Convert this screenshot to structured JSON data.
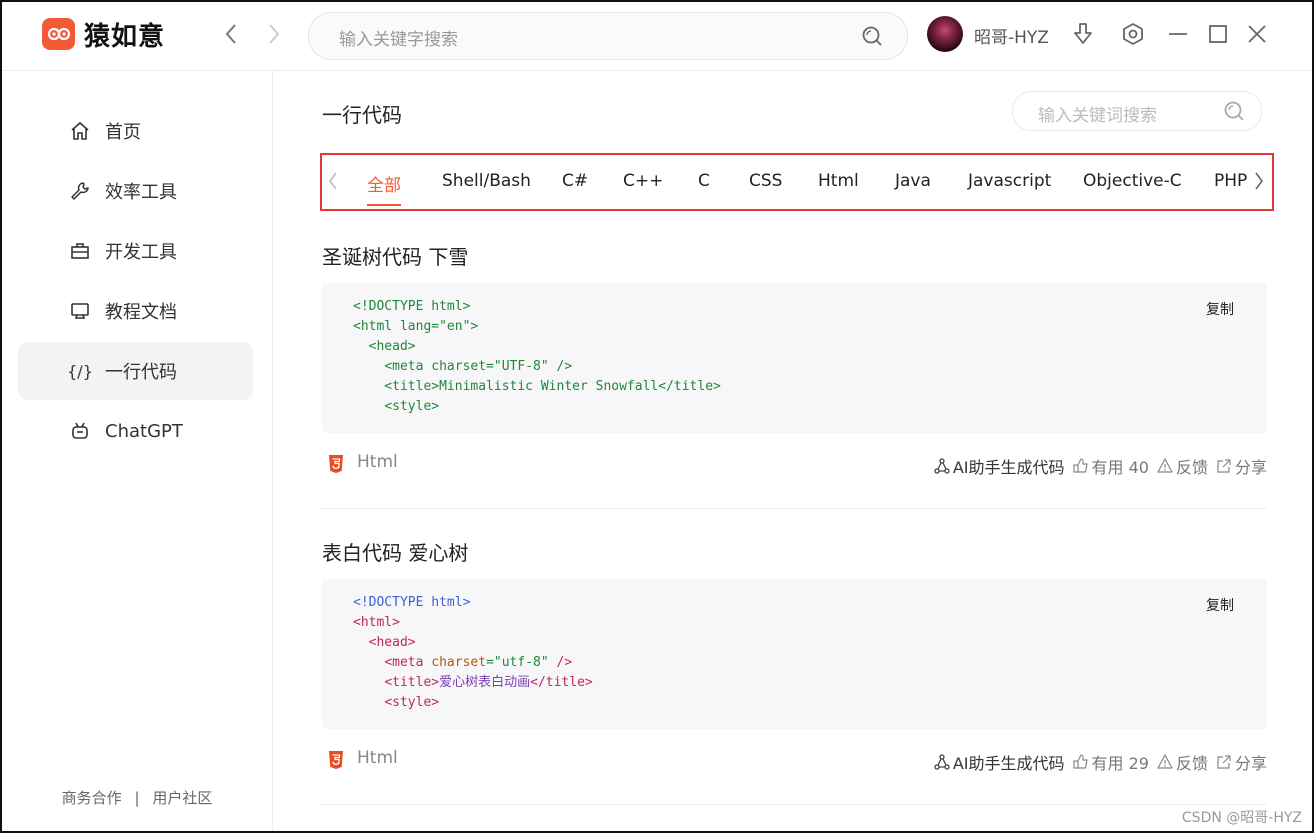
{
  "app": {
    "name": "猿如意"
  },
  "titlebar": {
    "search_placeholder": "输入关键字搜索",
    "username": "昭哥-HYZ"
  },
  "sidebar": {
    "items": [
      {
        "label": "首页",
        "icon": "home-icon"
      },
      {
        "label": "效率工具",
        "icon": "wrench-icon"
      },
      {
        "label": "开发工具",
        "icon": "briefcase-icon"
      },
      {
        "label": "教程文档",
        "icon": "monitor-icon"
      },
      {
        "label": "一行代码",
        "icon": "code-braces-icon",
        "glyph": "{/}",
        "active": true
      },
      {
        "label": "ChatGPT",
        "icon": "robot-icon"
      }
    ],
    "footer": {
      "business": "商务合作",
      "divider": "|",
      "community": "用户社区"
    }
  },
  "main": {
    "title": "一行代码",
    "search_placeholder": "输入关键词搜索",
    "tabs": [
      "全部",
      "Shell/Bash",
      "C#",
      "C++",
      "C",
      "CSS",
      "Html",
      "Java",
      "Javascript",
      "Objective-C",
      "PHP"
    ],
    "active_tab": "全部",
    "snippets": [
      {
        "title": "圣诞树代码 下雪",
        "copy_label": "复制",
        "code": [
          "<!DOCTYPE html>",
          "<html lang=\"en\">",
          "  <head>",
          "    <meta charset=\"UTF-8\" />",
          "    <title>Minimalistic Winter Snowfall</title>",
          "    <style>"
        ],
        "language": "Html",
        "ai_label": "AI助手生成代码",
        "useful_label": "有用 40",
        "feedback_label": "反馈",
        "share_label": "分享"
      },
      {
        "title": "表白代码 爱心树",
        "copy_label": "复制",
        "code": {
          "l1": "<!DOCTYPE html>",
          "l2": "<html>",
          "l3": "<head>",
          "l4a": "<meta",
          "l4b": "charset",
          "l4c": "=\"utf-8\"",
          "l4d": "/>",
          "l5a": "<title>",
          "l5b": "爱心树表白动画",
          "l5c": "</title>",
          "l6": "<style>"
        },
        "language": "Html",
        "ai_label": "AI助手生成代码",
        "useful_label": "有用 29",
        "feedback_label": "反馈",
        "share_label": "分享"
      }
    ]
  },
  "watermark": "CSDN @昭哥-HYZ",
  "colors": {
    "accent": "#f25a36",
    "highlight_border": "#e53935"
  }
}
